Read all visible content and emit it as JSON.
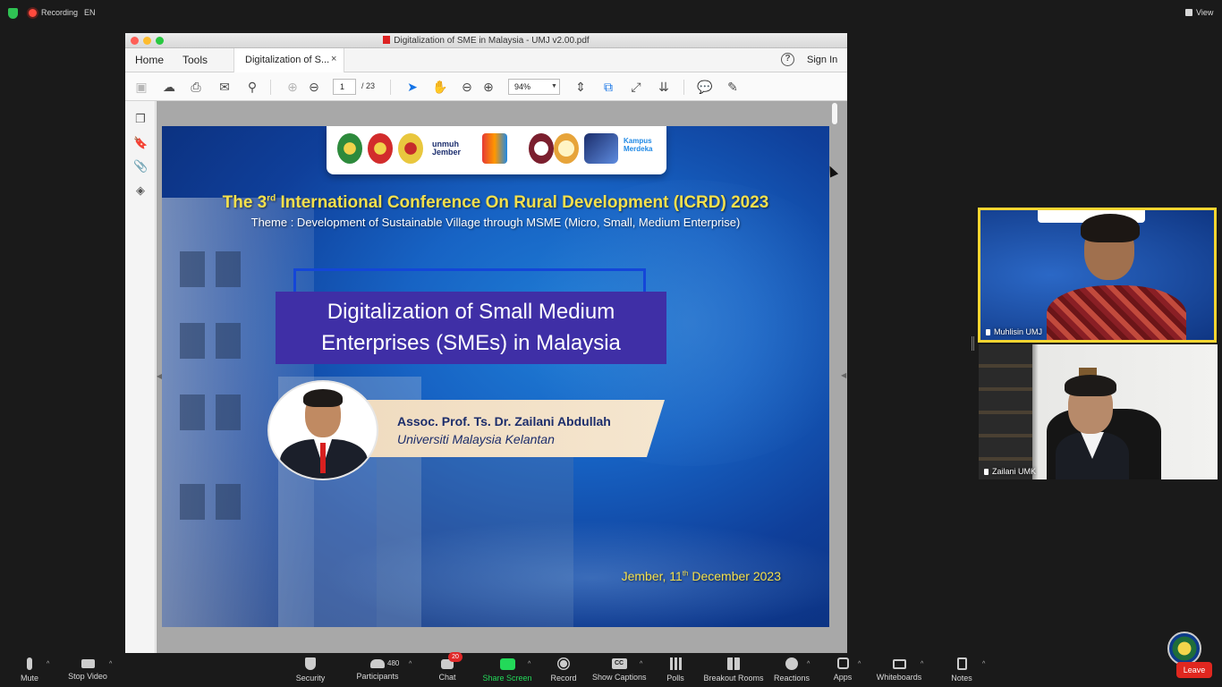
{
  "topbar": {
    "recording": "Recording",
    "language": "EN",
    "view": "View"
  },
  "acrobat": {
    "window_title": "Digitalization of SME in Malaysia - UMJ v2.00.pdf",
    "tabs": {
      "home": "Home",
      "tools": "Tools",
      "document": "Digitalization of S...",
      "close": "×"
    },
    "help": "?",
    "sign_in": "Sign In",
    "toolbar": {
      "page_current": "1",
      "page_total": "/ 23",
      "zoom": "94%"
    }
  },
  "slide": {
    "conference_title_pre": "The 3",
    "conference_title_sup": "rd",
    "conference_title_post": " International Conference On Rural Development (ICRD) 2023",
    "theme": "Theme : Development of Sustainable Village through MSME (Micro, Small, Medium Enterprise)",
    "talk_title_line1": "Digitalization of Small Medium",
    "talk_title_line2": "Enterprises (SMEs) in Malaysia",
    "speaker_name": "Assoc. Prof. Ts. Dr. Zailani Abdullah",
    "speaker_affiliation": "Universiti Malaysia Kelantan",
    "date_pre": "Jember, 11",
    "date_sup": "th",
    "date_post": " December 2023",
    "logos": {
      "unmuh_line1": "unmuh",
      "unmuh_line2": "Jember",
      "kampus_line1": "Kampus",
      "kampus_line2": "Merdeka"
    }
  },
  "participants_video": [
    {
      "name": "Muhlisin UMJ"
    },
    {
      "name": "Zailani UMK"
    }
  ],
  "bottombar": {
    "mute": "Mute",
    "stop_video": "Stop Video",
    "security": "Security",
    "participants": "Participants",
    "participants_count": "480",
    "chat": "Chat",
    "chat_count": "20",
    "share_screen": "Share Screen",
    "record": "Record",
    "show_captions": "Show Captions",
    "captions_icon": "CC",
    "polls": "Polls",
    "breakout_rooms": "Breakout Rooms",
    "reactions": "Reactions",
    "apps": "Apps",
    "whiteboards": "Whiteboards",
    "notes": "Notes",
    "leave": "Leave"
  },
  "colors": {
    "share_green": "#23d959",
    "leave_red": "#e0271f",
    "active_speaker": "#f5d531",
    "slide_yellow": "#f4e04d",
    "title_box": "#3f2fa6"
  }
}
